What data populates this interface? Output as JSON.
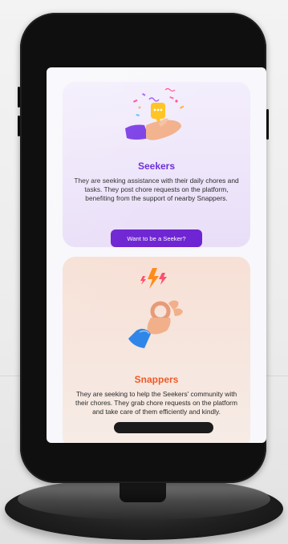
{
  "seekers": {
    "title": "Seekers",
    "description": "They are seeking assistance with their daily chores and tasks. They post chore requests on the platform, benefiting from the support of nearby Snappers.",
    "button_label": "Want to be a Seeker?",
    "accent_color": "#6e24d2",
    "illustration_icon": "hand-with-chat-bubble-and-confetti"
  },
  "snappers": {
    "title": "Snappers",
    "description": "They are seeking to help the Seekers' community with their chores. They grab chore requests on the platform and take care of them efficiently and kindly.",
    "accent_color": "#f05a28",
    "illustration_icon": "ok-hand-with-lightning"
  },
  "colors": {
    "seekers_card_bg": "#ede3fa",
    "snappers_card_bg": "#f7e3da",
    "phone_frame": "#0f0f0f"
  }
}
